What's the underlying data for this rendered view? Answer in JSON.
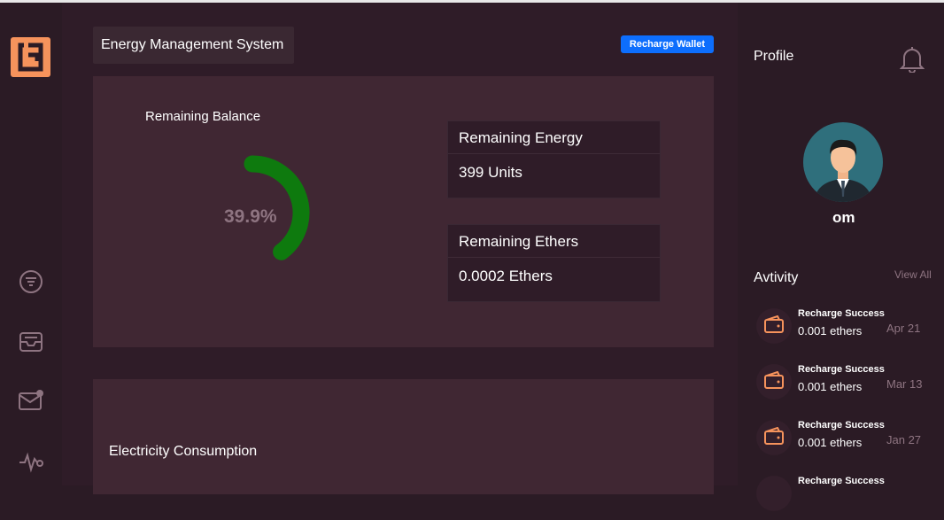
{
  "header": {
    "title": "Energy Management System",
    "recharge_button": "Recharge Wallet"
  },
  "balance": {
    "label": "Remaining Balance",
    "percent_text": "39.9%",
    "percent_value": 39.9,
    "gauge_color": "#0e7a0e"
  },
  "energy_card": {
    "title": "Remaining Energy",
    "value": "399 Units"
  },
  "ethers_card": {
    "title": "Remaining Ethers",
    "value": "0.0002 Ethers"
  },
  "consumption": {
    "title": "Electricity Consumption"
  },
  "sidebar": {
    "icons": [
      "filter-icon",
      "inbox-icon",
      "mail-icon",
      "activity-icon"
    ],
    "logo_color": "#f6935c"
  },
  "profile": {
    "title": "Profile",
    "username": "om"
  },
  "activity": {
    "title": "Avtivity",
    "view_all": "View All",
    "items": [
      {
        "title": "Recharge Success",
        "amount": "0.001 ethers",
        "date": "Apr 21"
      },
      {
        "title": "Recharge Success",
        "amount": "0.001 ethers",
        "date": "Mar 13"
      },
      {
        "title": "Recharge Success",
        "amount": "0.001 ethers",
        "date": "Jan 27"
      },
      {
        "title": "Recharge Success"
      }
    ]
  }
}
